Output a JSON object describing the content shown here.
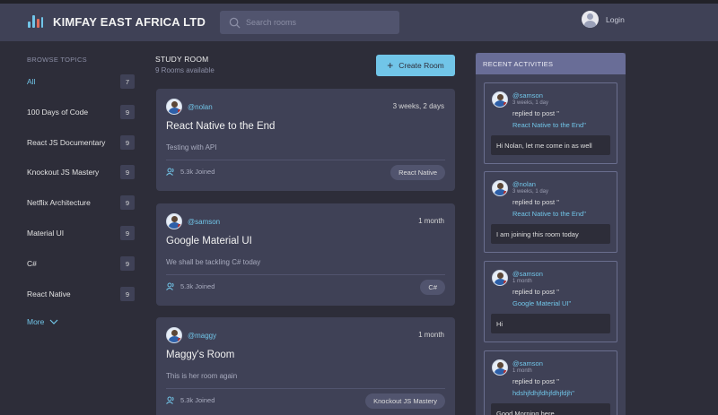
{
  "app": {
    "brand": "KIMFAY EAST AFRICA LTD",
    "login_label": "Login",
    "accent": "#71c5e8",
    "header_bg": "#3f4156",
    "body_bg": "#2d2d39"
  },
  "search": {
    "placeholder": "Search rooms"
  },
  "sidebar": {
    "title": "BROWSE TOPICS",
    "topics": [
      {
        "name": "All",
        "count": "7"
      },
      {
        "name": "100 Days of Code",
        "count": "9"
      },
      {
        "name": "React JS Documentary",
        "count": "9"
      },
      {
        "name": "Knockout JS Mastery",
        "count": "9"
      },
      {
        "name": "Netflix Architecture",
        "count": "9"
      },
      {
        "name": "Material UI",
        "count": "9"
      },
      {
        "name": "C#",
        "count": "9"
      },
      {
        "name": "React Native",
        "count": "9"
      }
    ],
    "more_label": "More"
  },
  "main": {
    "title": "STUDY ROOM",
    "subtitle": "9 Rooms available",
    "create_label": "Create Room",
    "rooms": [
      {
        "host": "@nolan",
        "time": "3 weeks, 2 days",
        "name": "React Native to the End",
        "description": "Testing with API",
        "joined": "5.3k Joined",
        "topic": "React Native"
      },
      {
        "host": "@samson",
        "time": "1 month",
        "name": "Google Material UI",
        "description": "We shall be tackling C# today",
        "joined": "5.3k Joined",
        "topic": "C#"
      },
      {
        "host": "@maggy",
        "time": "1 month",
        "name": "Maggy's Room",
        "description": "This is her room again",
        "joined": "5.3k Joined",
        "topic": "Knockout JS Mastery"
      }
    ]
  },
  "activities": {
    "title": "RECENT ACTIVITIES",
    "items": [
      {
        "user": "@samson",
        "time": "3 weeks, 1 day",
        "action": "replied to post \"",
        "post": "React Native to the End\"",
        "message": "Hi Nolan, let me come in as well"
      },
      {
        "user": "@nolan",
        "time": "3 weeks, 1 day",
        "action": "replied to post \"",
        "post": "React Native to the End\"",
        "message": "I am joining this room today"
      },
      {
        "user": "@samson",
        "time": "1 month",
        "action": "replied to post \"",
        "post": "Google Material UI\"",
        "message": "Hi"
      },
      {
        "user": "@samson",
        "time": "1 month",
        "action": "replied to post \"",
        "post": "hdshjfdhjfdhjfdhjfdjh\"",
        "message": "Good Morning here"
      }
    ]
  }
}
